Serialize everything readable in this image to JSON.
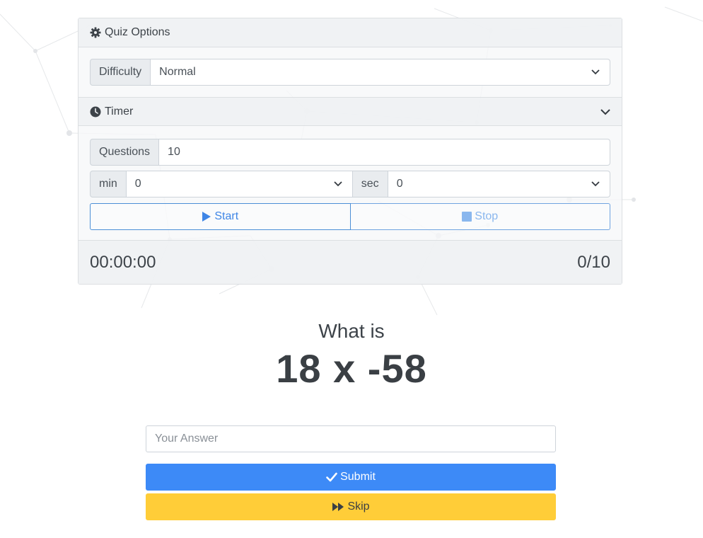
{
  "quiz_options": {
    "header_label": "Quiz Options",
    "header_icon": "gear-icon",
    "difficulty_label": "Difficulty",
    "difficulty_value": "Normal"
  },
  "timer": {
    "header_label": "Timer",
    "header_icon": "clock-icon",
    "questions_label": "Questions",
    "questions_value": "10",
    "min_label": "min",
    "min_value": "0",
    "sec_label": "sec",
    "sec_value": "0",
    "start_label": "Start",
    "stop_label": "Stop"
  },
  "status": {
    "elapsed": "00:00:00",
    "progress": "0/10"
  },
  "question": {
    "prompt": "What is",
    "expression": "18 x -58"
  },
  "answer": {
    "placeholder": "Your Answer",
    "submit_label": "Submit",
    "skip_label": "Skip"
  },
  "colors": {
    "primary": "#3d8af7",
    "warning": "#ffcd38",
    "outline": "#4b8fd6"
  }
}
